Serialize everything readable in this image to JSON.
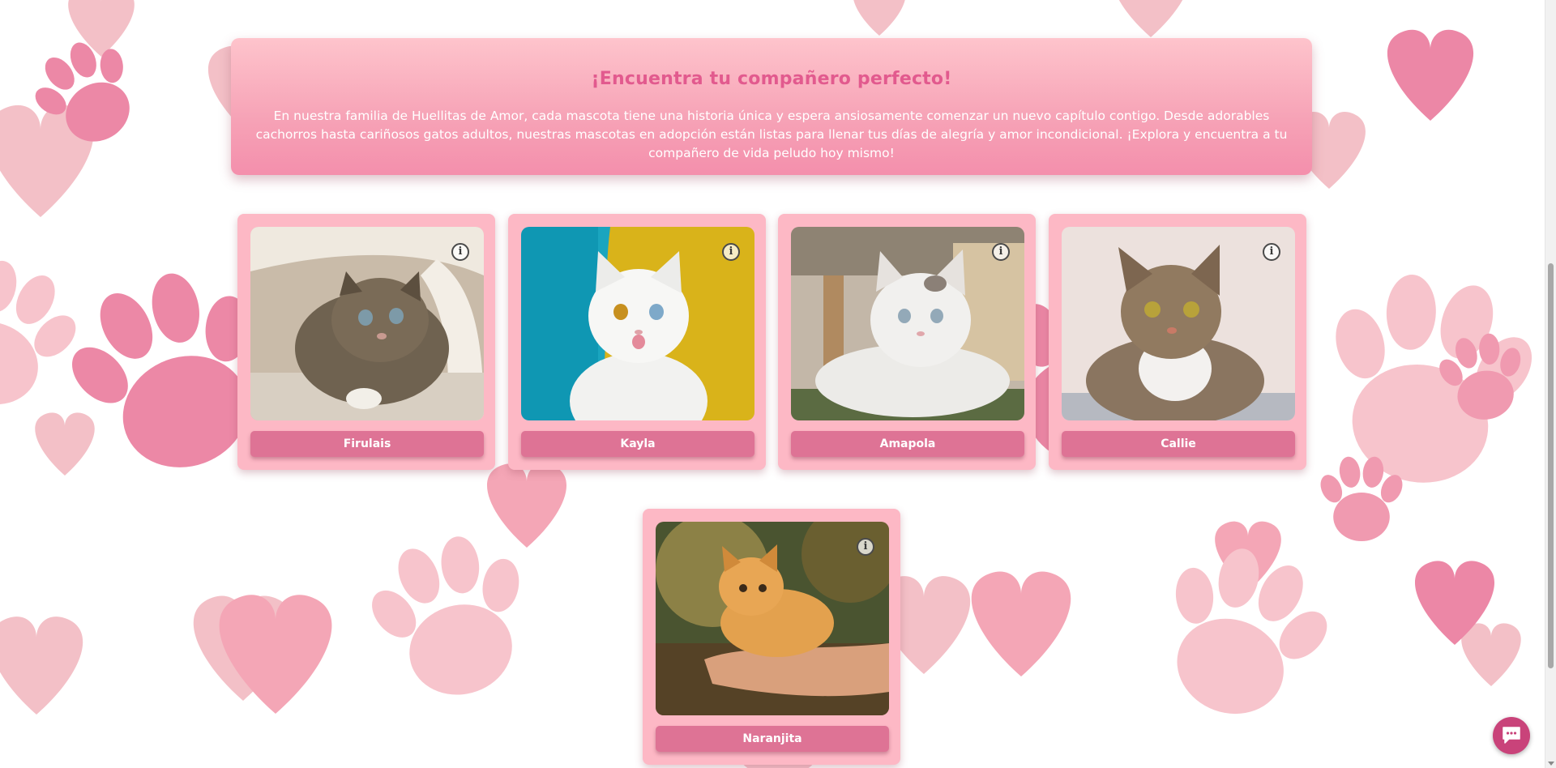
{
  "hero": {
    "title": "¡Encuentra tu compañero perfecto!",
    "description": "En nuestra familia de Huellitas de Amor, cada mascota tiene una historia única y espera ansiosamente comenzar un nuevo capítulo contigo. Desde adorables cachorros hasta cariñosos gatos adultos, nuestras mascotas en adopción están listas para llenar tus días de alegría y amor incondicional. ¡Explora y encuentra a tu compañero de vida peludo hoy mismo!"
  },
  "pets": [
    {
      "name": "Firulais",
      "info_glyph": "i"
    },
    {
      "name": "Kayla",
      "info_glyph": "i"
    },
    {
      "name": "Amapola",
      "info_glyph": "i"
    },
    {
      "name": "Callie",
      "info_glyph": "i"
    },
    {
      "name": "Naranjita",
      "info_glyph": "i"
    }
  ],
  "icons": {
    "info": "info-icon",
    "chat": "chat-icon"
  },
  "colors": {
    "hero_title": "#e25a8e",
    "card_bg": "#fdb8c5",
    "button": "#de7395",
    "chat_button": "#c9437a",
    "heart_light": "#f4c2c8",
    "paw_pink": "#eb86a4"
  }
}
